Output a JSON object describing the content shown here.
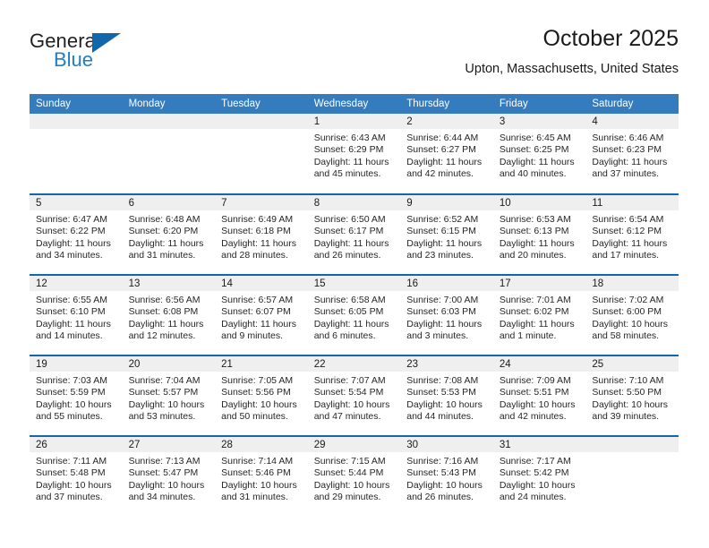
{
  "logo": {
    "word_top": "General",
    "word_bottom": "Blue",
    "triangle_color": "#1267ac",
    "blue_text_color": "#1f7ec4",
    "dark_text_color": "#231f20"
  },
  "header": {
    "title": "October 2025",
    "subtitle": "Upton, Massachusetts, United States"
  },
  "theme": {
    "header_blue": "#347cbd",
    "rule_blue": "#1267ac",
    "daynum_band": "#efefef"
  },
  "weekdays": [
    "Sunday",
    "Monday",
    "Tuesday",
    "Wednesday",
    "Thursday",
    "Friday",
    "Saturday"
  ],
  "weeks": [
    [
      {
        "day": "",
        "sunrise": "",
        "sunset": "",
        "daylight1": "",
        "daylight2": ""
      },
      {
        "day": "",
        "sunrise": "",
        "sunset": "",
        "daylight1": "",
        "daylight2": ""
      },
      {
        "day": "",
        "sunrise": "",
        "sunset": "",
        "daylight1": "",
        "daylight2": ""
      },
      {
        "day": "1",
        "sunrise": "Sunrise: 6:43 AM",
        "sunset": "Sunset: 6:29 PM",
        "daylight1": "Daylight: 11 hours",
        "daylight2": "and 45 minutes."
      },
      {
        "day": "2",
        "sunrise": "Sunrise: 6:44 AM",
        "sunset": "Sunset: 6:27 PM",
        "daylight1": "Daylight: 11 hours",
        "daylight2": "and 42 minutes."
      },
      {
        "day": "3",
        "sunrise": "Sunrise: 6:45 AM",
        "sunset": "Sunset: 6:25 PM",
        "daylight1": "Daylight: 11 hours",
        "daylight2": "and 40 minutes."
      },
      {
        "day": "4",
        "sunrise": "Sunrise: 6:46 AM",
        "sunset": "Sunset: 6:23 PM",
        "daylight1": "Daylight: 11 hours",
        "daylight2": "and 37 minutes."
      }
    ],
    [
      {
        "day": "5",
        "sunrise": "Sunrise: 6:47 AM",
        "sunset": "Sunset: 6:22 PM",
        "daylight1": "Daylight: 11 hours",
        "daylight2": "and 34 minutes."
      },
      {
        "day": "6",
        "sunrise": "Sunrise: 6:48 AM",
        "sunset": "Sunset: 6:20 PM",
        "daylight1": "Daylight: 11 hours",
        "daylight2": "and 31 minutes."
      },
      {
        "day": "7",
        "sunrise": "Sunrise: 6:49 AM",
        "sunset": "Sunset: 6:18 PM",
        "daylight1": "Daylight: 11 hours",
        "daylight2": "and 28 minutes."
      },
      {
        "day": "8",
        "sunrise": "Sunrise: 6:50 AM",
        "sunset": "Sunset: 6:17 PM",
        "daylight1": "Daylight: 11 hours",
        "daylight2": "and 26 minutes."
      },
      {
        "day": "9",
        "sunrise": "Sunrise: 6:52 AM",
        "sunset": "Sunset: 6:15 PM",
        "daylight1": "Daylight: 11 hours",
        "daylight2": "and 23 minutes."
      },
      {
        "day": "10",
        "sunrise": "Sunrise: 6:53 AM",
        "sunset": "Sunset: 6:13 PM",
        "daylight1": "Daylight: 11 hours",
        "daylight2": "and 20 minutes."
      },
      {
        "day": "11",
        "sunrise": "Sunrise: 6:54 AM",
        "sunset": "Sunset: 6:12 PM",
        "daylight1": "Daylight: 11 hours",
        "daylight2": "and 17 minutes."
      }
    ],
    [
      {
        "day": "12",
        "sunrise": "Sunrise: 6:55 AM",
        "sunset": "Sunset: 6:10 PM",
        "daylight1": "Daylight: 11 hours",
        "daylight2": "and 14 minutes."
      },
      {
        "day": "13",
        "sunrise": "Sunrise: 6:56 AM",
        "sunset": "Sunset: 6:08 PM",
        "daylight1": "Daylight: 11 hours",
        "daylight2": "and 12 minutes."
      },
      {
        "day": "14",
        "sunrise": "Sunrise: 6:57 AM",
        "sunset": "Sunset: 6:07 PM",
        "daylight1": "Daylight: 11 hours",
        "daylight2": "and 9 minutes."
      },
      {
        "day": "15",
        "sunrise": "Sunrise: 6:58 AM",
        "sunset": "Sunset: 6:05 PM",
        "daylight1": "Daylight: 11 hours",
        "daylight2": "and 6 minutes."
      },
      {
        "day": "16",
        "sunrise": "Sunrise: 7:00 AM",
        "sunset": "Sunset: 6:03 PM",
        "daylight1": "Daylight: 11 hours",
        "daylight2": "and 3 minutes."
      },
      {
        "day": "17",
        "sunrise": "Sunrise: 7:01 AM",
        "sunset": "Sunset: 6:02 PM",
        "daylight1": "Daylight: 11 hours",
        "daylight2": "and 1 minute."
      },
      {
        "day": "18",
        "sunrise": "Sunrise: 7:02 AM",
        "sunset": "Sunset: 6:00 PM",
        "daylight1": "Daylight: 10 hours",
        "daylight2": "and 58 minutes."
      }
    ],
    [
      {
        "day": "19",
        "sunrise": "Sunrise: 7:03 AM",
        "sunset": "Sunset: 5:59 PM",
        "daylight1": "Daylight: 10 hours",
        "daylight2": "and 55 minutes."
      },
      {
        "day": "20",
        "sunrise": "Sunrise: 7:04 AM",
        "sunset": "Sunset: 5:57 PM",
        "daylight1": "Daylight: 10 hours",
        "daylight2": "and 53 minutes."
      },
      {
        "day": "21",
        "sunrise": "Sunrise: 7:05 AM",
        "sunset": "Sunset: 5:56 PM",
        "daylight1": "Daylight: 10 hours",
        "daylight2": "and 50 minutes."
      },
      {
        "day": "22",
        "sunrise": "Sunrise: 7:07 AM",
        "sunset": "Sunset: 5:54 PM",
        "daylight1": "Daylight: 10 hours",
        "daylight2": "and 47 minutes."
      },
      {
        "day": "23",
        "sunrise": "Sunrise: 7:08 AM",
        "sunset": "Sunset: 5:53 PM",
        "daylight1": "Daylight: 10 hours",
        "daylight2": "and 44 minutes."
      },
      {
        "day": "24",
        "sunrise": "Sunrise: 7:09 AM",
        "sunset": "Sunset: 5:51 PM",
        "daylight1": "Daylight: 10 hours",
        "daylight2": "and 42 minutes."
      },
      {
        "day": "25",
        "sunrise": "Sunrise: 7:10 AM",
        "sunset": "Sunset: 5:50 PM",
        "daylight1": "Daylight: 10 hours",
        "daylight2": "and 39 minutes."
      }
    ],
    [
      {
        "day": "26",
        "sunrise": "Sunrise: 7:11 AM",
        "sunset": "Sunset: 5:48 PM",
        "daylight1": "Daylight: 10 hours",
        "daylight2": "and 37 minutes."
      },
      {
        "day": "27",
        "sunrise": "Sunrise: 7:13 AM",
        "sunset": "Sunset: 5:47 PM",
        "daylight1": "Daylight: 10 hours",
        "daylight2": "and 34 minutes."
      },
      {
        "day": "28",
        "sunrise": "Sunrise: 7:14 AM",
        "sunset": "Sunset: 5:46 PM",
        "daylight1": "Daylight: 10 hours",
        "daylight2": "and 31 minutes."
      },
      {
        "day": "29",
        "sunrise": "Sunrise: 7:15 AM",
        "sunset": "Sunset: 5:44 PM",
        "daylight1": "Daylight: 10 hours",
        "daylight2": "and 29 minutes."
      },
      {
        "day": "30",
        "sunrise": "Sunrise: 7:16 AM",
        "sunset": "Sunset: 5:43 PM",
        "daylight1": "Daylight: 10 hours",
        "daylight2": "and 26 minutes."
      },
      {
        "day": "31",
        "sunrise": "Sunrise: 7:17 AM",
        "sunset": "Sunset: 5:42 PM",
        "daylight1": "Daylight: 10 hours",
        "daylight2": "and 24 minutes."
      },
      {
        "day": "",
        "sunrise": "",
        "sunset": "",
        "daylight1": "",
        "daylight2": ""
      }
    ]
  ]
}
